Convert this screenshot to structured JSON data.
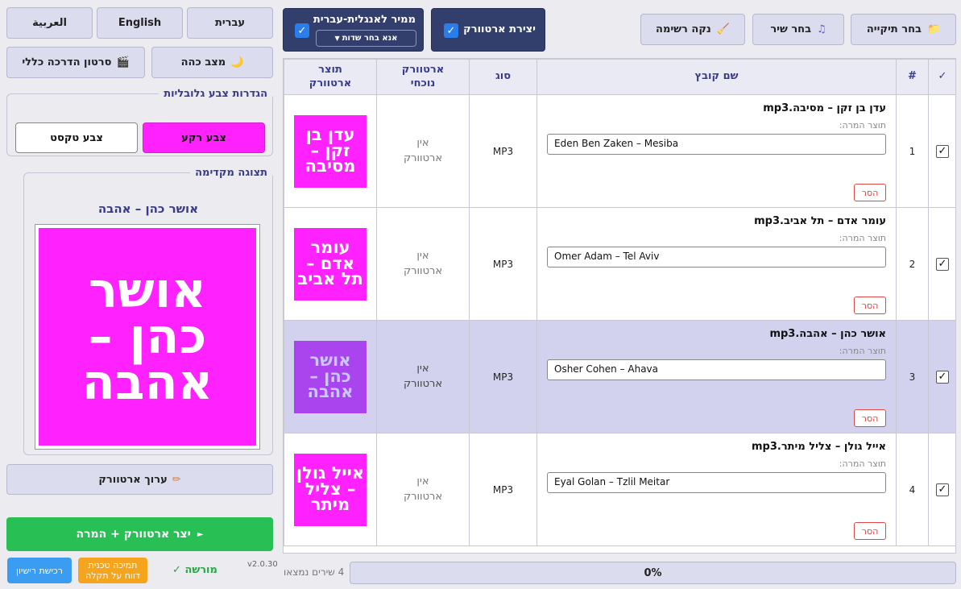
{
  "languages": {
    "hebrew": "עברית",
    "english": "English",
    "arabic": "العربية"
  },
  "left": {
    "dark_mode": "מצב כהה",
    "tutorial": "סרטון הדרכה כללי",
    "global_colors_legend": "הגדרות צבע גלובליות",
    "bg_color_label": "צבע רקע",
    "text_color_label": "צבע טקסט",
    "preview_legend": "תצוגה מקדימה",
    "preview_title": "אושר כהן – אהבה",
    "preview_lines": [
      "אושר",
      "כהן –",
      "אהבה"
    ],
    "edit_artwork": "ערוך ארטוורק",
    "generate": "יצר ארטוורק + המרה",
    "license_purchase": "רכישת רישיון",
    "support_line1": "תמיכה טכנית",
    "support_line2": "דווח על תקלה",
    "licensed": "מורשה",
    "version": "v2.0.30"
  },
  "toolbar": {
    "choose_folder": "בחר תיקייה",
    "choose_song": "בחר שיר",
    "clear_list": "נקה רשימה",
    "create_artwork": "יצירת ארטוורק",
    "converter": "ממיר לאנגלית-עברית",
    "select_fields": "אנא בחר שדות"
  },
  "table": {
    "headers": {
      "check": "✓",
      "num": "#",
      "file_name": "שם קובץ",
      "type": "סוג",
      "current_artwork": [
        "ארטוורק",
        "נוכחי"
      ],
      "artwork_product": [
        "תוצר",
        "ארטוורק"
      ]
    },
    "convert_label": "תוצר המרה:",
    "remove_label": "הסר",
    "no_artwork": [
      "אין",
      "ארטוורק"
    ],
    "rows": [
      {
        "num": "1",
        "file": "עדן בן זקן – מסיבה.mp3",
        "converted": "Eden Ben Zaken – Mesiba",
        "type": "MP3",
        "art_lines": [
          "עדן בן",
          "זקן –",
          "מסיבה"
        ]
      },
      {
        "num": "2",
        "file": "עומר אדם – תל אביב.mp3",
        "converted": "Omer Adam – Tel Aviv",
        "type": "MP3",
        "art_lines": [
          "עומר",
          "אדם –",
          "תל אביב"
        ]
      },
      {
        "num": "3",
        "file": "אושר כהן – אהבה.mp3",
        "converted": "Osher Cohen – Ahava",
        "type": "MP3",
        "art_lines": [
          "אושר",
          "כהן –",
          "אהבה"
        ]
      },
      {
        "num": "4",
        "file": "אייל גולן – צליל מיתר.mp3",
        "converted": "Eyal Golan – Tzlil Meitar",
        "type": "MP3",
        "art_lines": [
          "אייל גולן",
          "– צליל",
          "מיתר"
        ]
      }
    ]
  },
  "status": {
    "songs_found": "4 שירים נמצאו",
    "progress_text": "0%",
    "progress_percent": 0
  },
  "colors": {
    "magenta": "#ff22ff",
    "purple_art": "#aa44ee",
    "purple_text": "#c8c8ff",
    "accent_dark": "#323e6b",
    "green": "#28bf55"
  }
}
